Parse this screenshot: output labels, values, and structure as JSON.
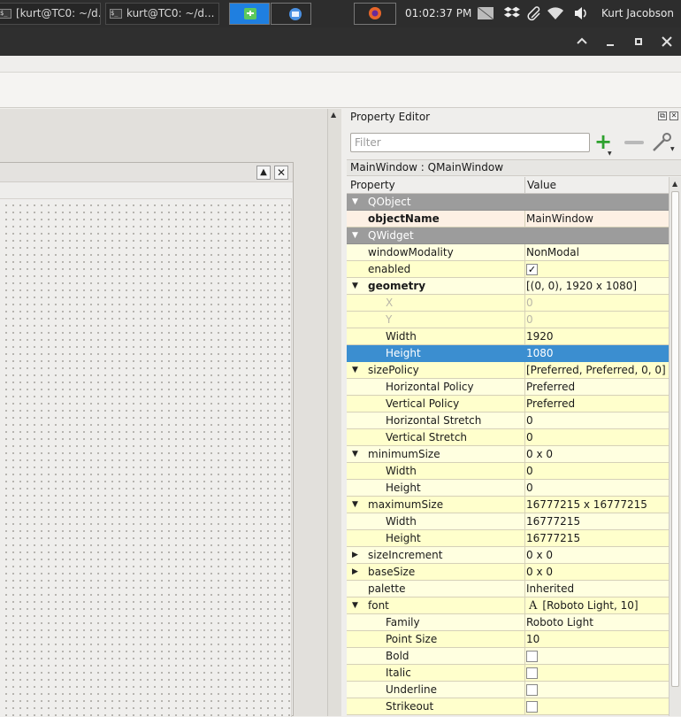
{
  "taskbar": {
    "tasks": [
      {
        "label": "[kurt@TC0: ~/d..."
      },
      {
        "label": "kurt@TC0: ~/d..."
      }
    ],
    "clock": "01:02:37 PM",
    "user": "Kurt Jacobson"
  },
  "property_editor": {
    "title": "Property Editor",
    "filter_placeholder": "Filter",
    "object_label": "MainWindow : QMainWindow",
    "header": {
      "property": "Property",
      "value": "Value"
    },
    "rows": [
      {
        "name": "QObject",
        "value": "",
        "kind": "group",
        "twisty": "▼"
      },
      {
        "name": "objectName",
        "value": "MainWindow",
        "kind": "objname",
        "twisty": ""
      },
      {
        "name": "QWidget",
        "value": "",
        "kind": "group",
        "twisty": "▼"
      },
      {
        "name": "windowModality",
        "value": "NonModal",
        "kind": "normal",
        "twisty": ""
      },
      {
        "name": "enabled",
        "value": "",
        "kind": "check",
        "checked": true,
        "twisty": ""
      },
      {
        "name": "geometry",
        "value": "[(0, 0), 1920 x 1080]",
        "kind": "bold",
        "twisty": "▼"
      },
      {
        "name": "X",
        "value": "0",
        "kind": "disabled",
        "twisty": ""
      },
      {
        "name": "Y",
        "value": "0",
        "kind": "disabled",
        "twisty": ""
      },
      {
        "name": "Width",
        "value": "1920",
        "kind": "sub",
        "twisty": ""
      },
      {
        "name": "Height",
        "value": "1080",
        "kind": "selected",
        "twisty": ""
      },
      {
        "name": "sizePolicy",
        "value": "[Preferred, Preferred, 0, 0]",
        "kind": "normal",
        "twisty": "▼"
      },
      {
        "name": "Horizontal Policy",
        "value": "Preferred",
        "kind": "sub",
        "twisty": ""
      },
      {
        "name": "Vertical Policy",
        "value": "Preferred",
        "kind": "sub",
        "twisty": ""
      },
      {
        "name": "Horizontal Stretch",
        "value": "0",
        "kind": "sub",
        "twisty": ""
      },
      {
        "name": "Vertical Stretch",
        "value": "0",
        "kind": "sub",
        "twisty": ""
      },
      {
        "name": "minimumSize",
        "value": "0 x 0",
        "kind": "normal",
        "twisty": "▼"
      },
      {
        "name": "Width",
        "value": "0",
        "kind": "sub",
        "twisty": ""
      },
      {
        "name": "Height",
        "value": "0",
        "kind": "sub",
        "twisty": ""
      },
      {
        "name": "maximumSize",
        "value": "16777215 x 16777215",
        "kind": "normal",
        "twisty": "▼"
      },
      {
        "name": "Width",
        "value": "16777215",
        "kind": "sub",
        "twisty": ""
      },
      {
        "name": "Height",
        "value": "16777215",
        "kind": "sub",
        "twisty": ""
      },
      {
        "name": "sizeIncrement",
        "value": "0 x 0",
        "kind": "normal",
        "twisty": "▶"
      },
      {
        "name": "baseSize",
        "value": "0 x 0",
        "kind": "normal",
        "twisty": "▶"
      },
      {
        "name": "palette",
        "value": "Inherited",
        "kind": "normal",
        "twisty": ""
      },
      {
        "name": "font",
        "value": "[Roboto Light, 10]",
        "kind": "font",
        "icon_glyph": "A",
        "twisty": "▼"
      },
      {
        "name": "Family",
        "value": "Roboto Light",
        "kind": "sub",
        "twisty": ""
      },
      {
        "name": "Point Size",
        "value": "10",
        "kind": "sub",
        "twisty": ""
      },
      {
        "name": "Bold",
        "value": "",
        "kind": "subcheck",
        "checked": false,
        "twisty": ""
      },
      {
        "name": "Italic",
        "value": "",
        "kind": "subcheck",
        "checked": false,
        "twisty": ""
      },
      {
        "name": "Underline",
        "value": "",
        "kind": "subcheck",
        "checked": false,
        "twisty": ""
      },
      {
        "name": "Strikeout",
        "value": "",
        "kind": "subcheck",
        "checked": false,
        "twisty": ""
      }
    ]
  },
  "colors": {
    "selection": "#3b8ed0",
    "group_header": "#9c9c9c",
    "row_bg": "#ffffcc",
    "object_name_bg": "#fdf0e4"
  }
}
